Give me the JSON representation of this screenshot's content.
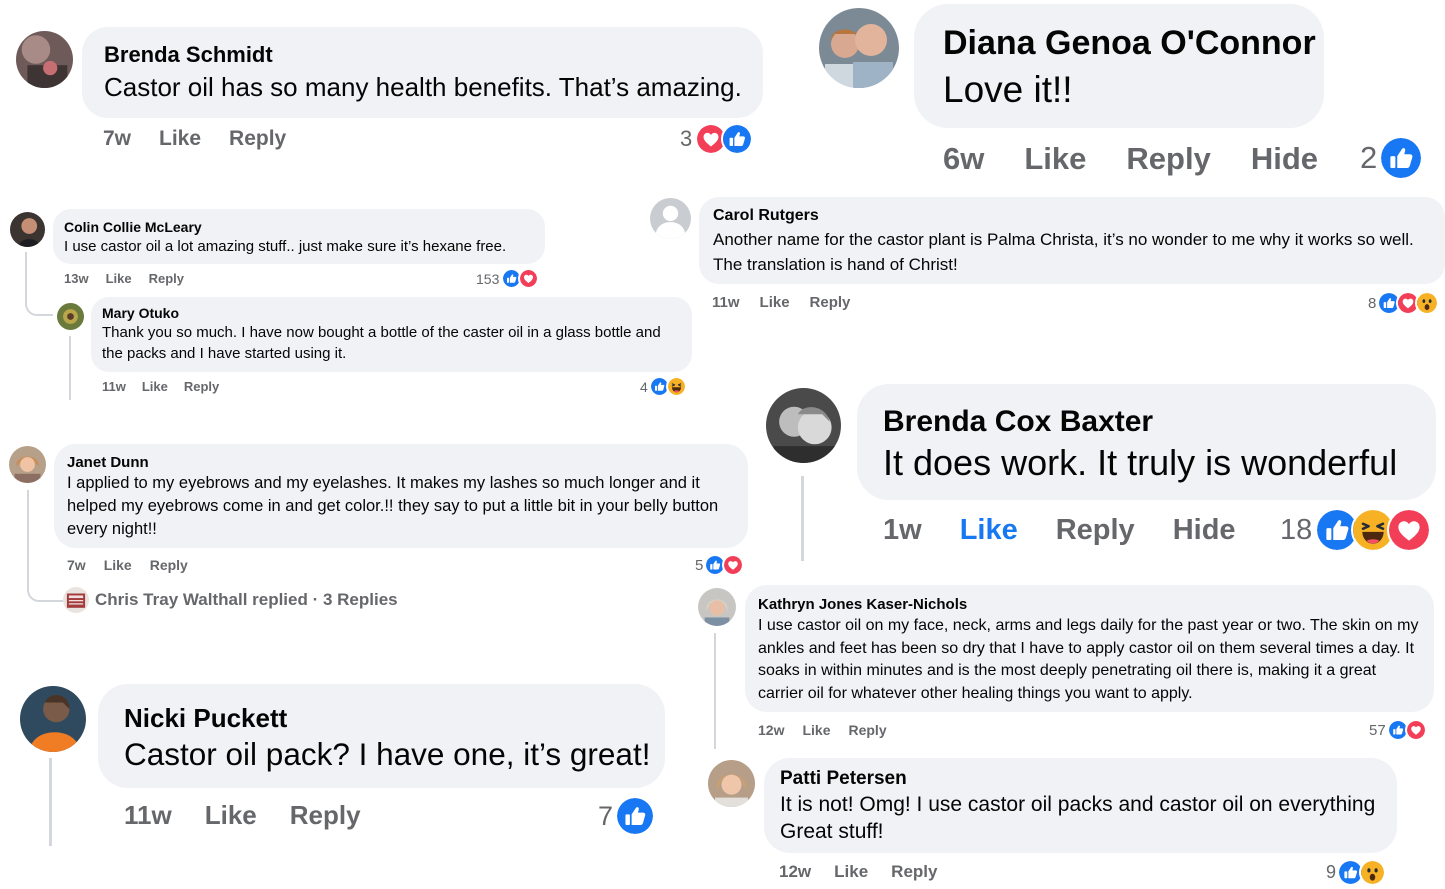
{
  "actions": {
    "like": "Like",
    "reply": "Reply",
    "hide": "Hide"
  },
  "colors": {
    "bubble": "#f0f2f5",
    "meta": "#65676b",
    "like_active": "#1877f2",
    "like_icon": "#1877f2",
    "love_icon": "#f33e58",
    "haha_icon": "#f7b125"
  },
  "comments": [
    {
      "name": "Brenda Schmidt",
      "text": "Castor oil has so many health benefits. That’s amazing.",
      "time": "7w",
      "reaction_count": "3",
      "reactions": [
        "love-icon",
        "like-icon"
      ]
    },
    {
      "name": "Diana Genoa O'Connor",
      "text": "Love it!!",
      "time": "6w",
      "reaction_count": "2",
      "reactions": [
        "like-icon"
      ]
    },
    {
      "name": "Colin Collie McLeary",
      "text": "I use castor oil a lot amazing stuff.. just make sure it’s hexane free.",
      "time": "13w",
      "reaction_count": "153",
      "reactions": [
        "like-icon",
        "love-icon"
      ]
    },
    {
      "name": "Mary Otuko",
      "text": "Thank you so much. I have now bought a bottle of the caster oil in a glass bottle and the packs and I have started using it.",
      "time": "11w",
      "reaction_count": "4",
      "reactions": [
        "like-icon",
        "haha-icon"
      ]
    },
    {
      "name": "Carol Rutgers",
      "text": "Another name for the castor plant is Palma Christa, it’s no wonder to me why it works so well. The translation is hand of Christ!",
      "time": "11w",
      "reaction_count": "8",
      "reactions": [
        "like-icon",
        "love-icon",
        "wow-icon"
      ]
    },
    {
      "name": "Brenda Cox Baxter",
      "text": "It does work. It truly is wonderful",
      "time": "1w",
      "reaction_count": "18",
      "reactions": [
        "like-icon",
        "haha-icon",
        "love-icon"
      ],
      "liked": true
    },
    {
      "name": "Janet Dunn",
      "text": "I applied to my eyebrows and my eyelashes. It makes my lashes so much longer and it helped my eyebrows come in and get color.!! they say to put a little bit in your belly button every night!!",
      "time": "7w",
      "reaction_count": "5",
      "reactions": [
        "like-icon",
        "love-icon"
      ],
      "replies_link": "Chris Tray Walthall replied · 3 Replies"
    },
    {
      "name": "Kathryn Jones Kaser-Nichols",
      "text": "I use castor oil on my face, neck, arms and legs daily for the past year or two. The skin on my ankles and feet has been so dry that I have to apply castor oil on them several times a day. It soaks in within minutes and is the most deeply penetrating oil there is, making it a great carrier oil for whatever other healing things you want to apply.",
      "time": "12w",
      "reaction_count": "57",
      "reactions": [
        "like-icon",
        "love-icon"
      ]
    },
    {
      "name": "Nicki Puckett",
      "text": "Castor oil pack? I have one, it’s great!",
      "time": "11w",
      "reaction_count": "7",
      "reactions": [
        "like-icon"
      ]
    },
    {
      "name": "Patti Petersen",
      "text": "It is not! Omg! I use castor oil packs and castor oil on everything Great stuff!",
      "time": "12w",
      "reaction_count": "9",
      "reactions": [
        "like-icon",
        "wow-icon"
      ]
    }
  ]
}
